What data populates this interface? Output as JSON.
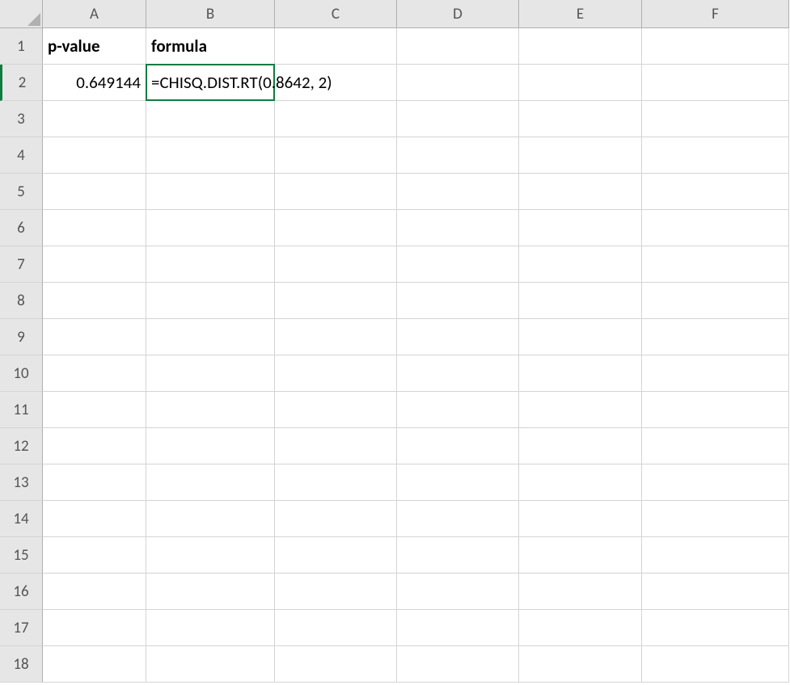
{
  "columns": [
    "A",
    "B",
    "C",
    "D",
    "E",
    "F"
  ],
  "row_count": 18,
  "active_row": 2,
  "cells": {
    "A1": {
      "text": "p-value",
      "bold": true,
      "align": "left",
      "interactable": true
    },
    "B1": {
      "text": "formula",
      "bold": true,
      "align": "left",
      "interactable": true
    },
    "A2": {
      "text": "0.649144",
      "align": "right",
      "interactable": true
    },
    "B2": {
      "text": "=CHISQ.DIST.RT(0.8642, 2)",
      "align": "left",
      "editing": true,
      "interactable": true
    }
  },
  "colors": {
    "accent": "#107c41",
    "grid_line": "#d4d4d4",
    "header_bg": "#e6e6e6"
  }
}
